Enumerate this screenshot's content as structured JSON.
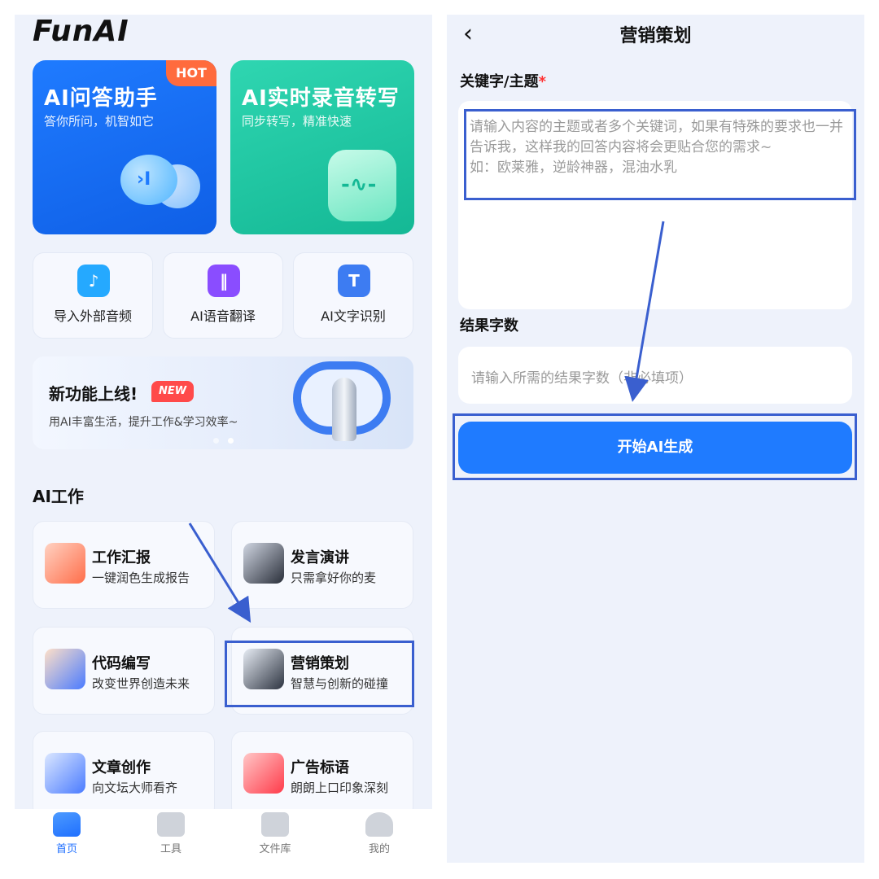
{
  "left": {
    "logo": "FunAI",
    "hero": [
      {
        "title": "AI问答助手",
        "subtitle": "答你所问，机智如它",
        "badge": "HOT"
      },
      {
        "title": "AI实时录音转写",
        "subtitle": "同步转写，精准快速"
      }
    ],
    "quick": [
      {
        "label": "导入外部音频",
        "icon": "music-note-icon",
        "color": "#25a9ff"
      },
      {
        "label": "AI语音翻译",
        "icon": "audio-wave-icon",
        "color": "#8a4dff"
      },
      {
        "label": "AI文字识别",
        "icon": "text-scan-icon",
        "color": "#3d7cf2"
      }
    ],
    "banner": {
      "title": "新功能上线!",
      "badge": "NEW",
      "desc": "用AI丰富生活，提升工作&学习效率~"
    },
    "section_title": "AI工作",
    "work": [
      {
        "title": "工作汇报",
        "desc": "一键润色生成报告"
      },
      {
        "title": "发言演讲",
        "desc": "只需拿好你的麦"
      },
      {
        "title": "代码编写",
        "desc": "改变世界创造未来"
      },
      {
        "title": "营销策划",
        "desc": "智慧与创新的碰撞"
      },
      {
        "title": "文章创作",
        "desc": "向文坛大师看齐"
      },
      {
        "title": "广告标语",
        "desc": "朗朗上口印象深刻"
      }
    ],
    "tabs": [
      {
        "label": "首页",
        "active": true
      },
      {
        "label": "工具"
      },
      {
        "label": "文件库"
      },
      {
        "label": "我的"
      }
    ]
  },
  "right": {
    "back_icon": "chevron-left-icon",
    "title": "营销策划",
    "keyword_label": "关键字/主题",
    "required_mark": "*",
    "keyword_placeholder": "请输入内容的主题或者多个关键词，如果有特殊的要求也一并告诉我，这样我的回答内容将会更贴合您的需求~\n如：欧莱雅，逆龄神器，混油水乳",
    "count_label": "结果字数",
    "count_placeholder": "请输入所需的结果字数（非必填项）",
    "generate_button": "开始AI生成"
  },
  "colors": {
    "primary": "#1f7bff",
    "annotation": "#3a5fcf",
    "hot": "#ff6b3d"
  }
}
